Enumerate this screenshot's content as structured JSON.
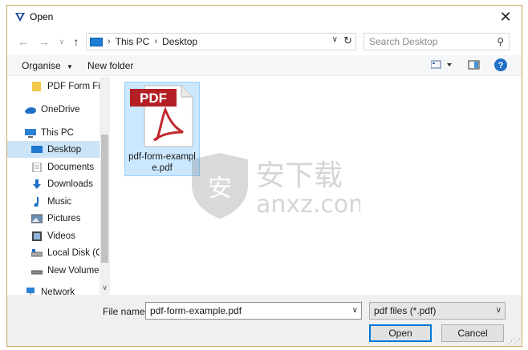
{
  "window": {
    "title": "Open"
  },
  "nav": {
    "breadcrumb": [
      "This PC",
      "Desktop"
    ],
    "search_placeholder": "Search Desktop"
  },
  "toolbar": {
    "organise": "Organise",
    "new_folder": "New folder"
  },
  "sidebar": {
    "items": [
      {
        "label": "PDF Form Fill",
        "icon": "folder-icon"
      },
      {
        "label": "OneDrive",
        "icon": "cloud-icon"
      },
      {
        "label": "This PC",
        "icon": "computer-icon"
      },
      {
        "label": "Desktop",
        "icon": "desktop-icon",
        "selected": true
      },
      {
        "label": "Documents",
        "icon": "document-icon"
      },
      {
        "label": "Downloads",
        "icon": "download-icon"
      },
      {
        "label": "Music",
        "icon": "music-icon"
      },
      {
        "label": "Pictures",
        "icon": "picture-icon"
      },
      {
        "label": "Videos",
        "icon": "video-icon"
      },
      {
        "label": "Local Disk (C:",
        "icon": "disk-icon"
      },
      {
        "label": "New Volume",
        "icon": "drive-icon"
      },
      {
        "label": "Network",
        "icon": "network-icon"
      }
    ]
  },
  "files": [
    {
      "name": "pdf-form-exampl e.pdf",
      "badge": "PDF"
    }
  ],
  "watermark": {
    "cn": "安下载",
    "latin": "anxz.com",
    "shield": "安"
  },
  "bottom": {
    "file_name_label": "File name:",
    "file_name_value": "pdf-form-example.pdf",
    "file_type": "pdf files (*.pdf)",
    "open_label": "Open",
    "cancel_label": "Cancel"
  },
  "colors": {
    "accent": "#0078d7",
    "selection": "#cce8ff",
    "pdf_red": "#c1272d"
  }
}
